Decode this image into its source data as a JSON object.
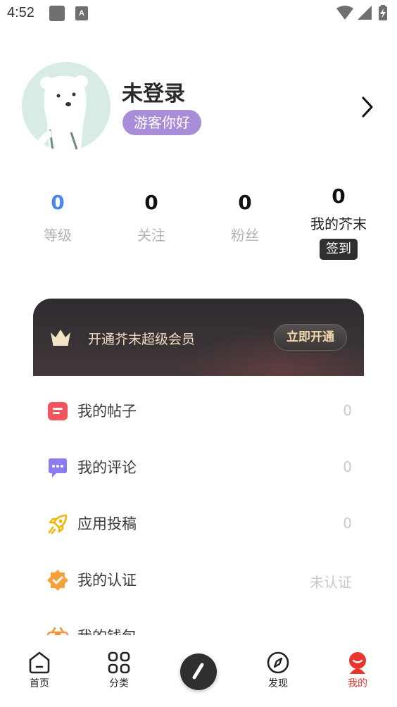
{
  "status_bar": {
    "time": "4:52",
    "app_icon_letter": "A"
  },
  "profile": {
    "username": "未登录",
    "badge": "游客你好"
  },
  "stats": {
    "level": {
      "value": "0",
      "label": "等级"
    },
    "following": {
      "value": "0",
      "label": "关注"
    },
    "fans": {
      "value": "0",
      "label": "粉丝"
    },
    "mustard": {
      "value": "0",
      "label": "我的芥末",
      "signin_label": "签到"
    }
  },
  "vip": {
    "text": "开通芥末超级会员",
    "button_label": "立即开通"
  },
  "menu": {
    "items": [
      {
        "label": "我的帖子",
        "value": "0",
        "icon": "posts-icon",
        "color": "#f2555b"
      },
      {
        "label": "我的评论",
        "value": "0",
        "icon": "comments-icon",
        "color": "#8c7cf2"
      },
      {
        "label": "应用投稿",
        "value": "0",
        "icon": "rocket-icon",
        "color": "#f3b400"
      },
      {
        "label": "我的认证",
        "value": "未认证",
        "icon": "verified-badge-icon",
        "color": "#f7a13a"
      },
      {
        "label": "我的钱包",
        "value": "",
        "icon": "wallet-icon",
        "color": "#f7913a"
      }
    ]
  },
  "bottom_nav": {
    "home": "首页",
    "category": "分类",
    "discover": "发现",
    "mine": "我的",
    "active_color": "#e8362e"
  }
}
